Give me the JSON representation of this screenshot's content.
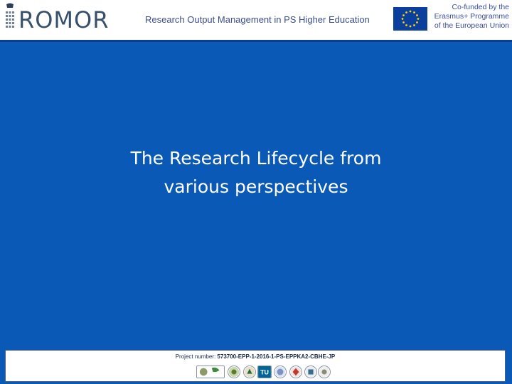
{
  "header": {
    "logo_text": "ROMOR",
    "title": "Research Output Management in PS Higher Education",
    "eu_flag_icon": "eu-flag-icon",
    "eu_lines": [
      "Co-funded by the",
      "Erasmus+ Programme",
      "of the European Union"
    ]
  },
  "slide": {
    "title_lines": [
      "The Research Lifecycle from",
      "various perspectives"
    ]
  },
  "footer": {
    "project_label": "Project number:",
    "project_number": "573700-EPP-1-2016-1-PS-EPPKA2-CBHE-JP",
    "partner_logos": [
      "partner-logo-icon",
      "partner-logo-icon",
      "partner-logo-icon",
      "tu-wien-logo-icon",
      "partner-logo-icon",
      "partner-logo-icon",
      "partner-logo-icon",
      "partner-logo-icon"
    ]
  },
  "colors": {
    "background": "#0b59b7",
    "header_rule": "#0a3f8a",
    "title_text": "#ffffff"
  }
}
